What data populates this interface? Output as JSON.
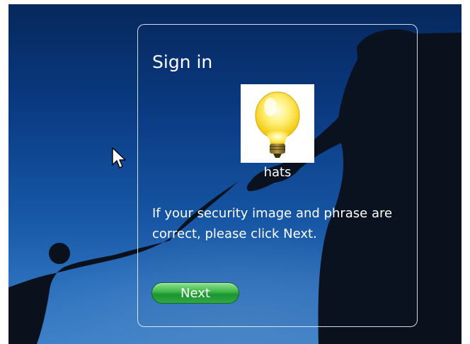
{
  "signin": {
    "title": "Sign in",
    "phrase": "hats",
    "message": "If your security image and phrase are correct, please click Next.",
    "next_label": "Next"
  },
  "icons": {
    "security_image": "lightbulb-icon",
    "cursor": "mouse-pointer-icon"
  },
  "colors": {
    "background_top": "#06285c",
    "background_bottom": "#3c80c8",
    "button_green": "#2aa43c",
    "text": "#ffffff"
  }
}
